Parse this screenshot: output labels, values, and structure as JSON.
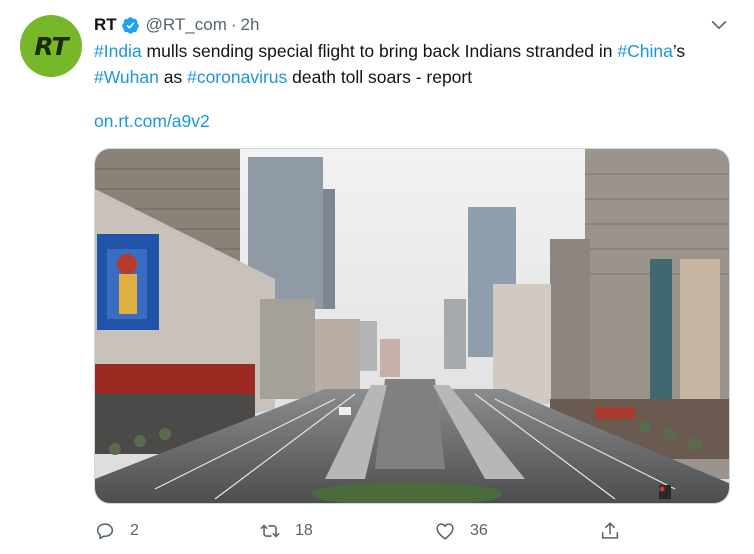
{
  "account": {
    "avatar_text": "RT",
    "name": "RT",
    "handle": "@RT_com",
    "separator": "·",
    "time": "2h"
  },
  "tweet": {
    "segments": [
      {
        "text": "#India",
        "hashtag": true
      },
      {
        "text": " mulls sending special flight to bring back Indians stranded in ",
        "hashtag": false
      },
      {
        "text": "#China",
        "hashtag": true
      },
      {
        "text": "’s ",
        "hashtag": false
      },
      {
        "text": "#Wuhan",
        "hashtag": true
      },
      {
        "text": " as ",
        "hashtag": false
      },
      {
        "text": "#coronavirus",
        "hashtag": true
      },
      {
        "text": " death toll soars - report",
        "hashtag": false
      }
    ],
    "link": "on.rt.com/a9v2"
  },
  "actions": {
    "reply_count": "2",
    "retweet_count": "18",
    "like_count": "36"
  },
  "icons": {
    "verified": "verified-badge-icon",
    "caret": "chevron-down-icon",
    "reply": "reply-icon",
    "retweet": "retweet-icon",
    "like": "heart-icon",
    "share": "share-icon"
  },
  "colors": {
    "avatar_bg": "#77b82a",
    "link": "#1b95e0",
    "verified": "#1da1f2",
    "secondary_text": "#536471"
  }
}
